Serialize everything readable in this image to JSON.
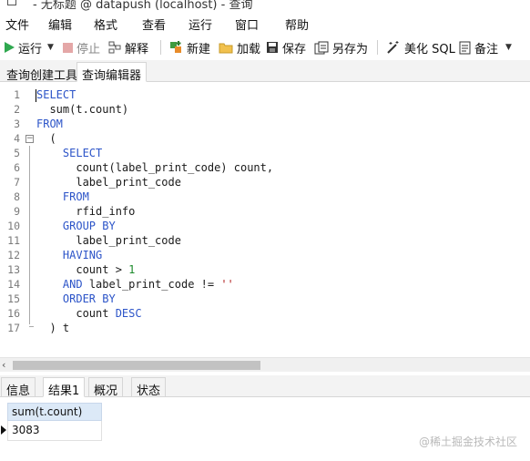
{
  "window": {
    "title": "- 无标题 @ datapush (localhost) - 查询"
  },
  "menu": [
    "文件",
    "编辑",
    "格式",
    "查看",
    "运行",
    "窗口",
    "帮助"
  ],
  "toolbar": {
    "run": "运行",
    "stop": "停止",
    "explain": "解释",
    "new": "新建",
    "load": "加载",
    "save": "保存",
    "save_as": "另存为",
    "beautify": "美化 SQL",
    "comment": "备注"
  },
  "editor_tabs": [
    "查询创建工具",
    "查询编辑器"
  ],
  "active_editor_tab": "查询编辑器",
  "code_lines": [
    {
      "n": "1",
      "parts": [
        [
          "kw",
          "SELECT"
        ]
      ]
    },
    {
      "n": "2",
      "parts": [
        [
          "t",
          "  sum(t.count)"
        ]
      ]
    },
    {
      "n": "3",
      "parts": [
        [
          "kw",
          "FROM"
        ]
      ]
    },
    {
      "n": "4",
      "parts": [
        [
          "t",
          "  ("
        ]
      ]
    },
    {
      "n": "5",
      "parts": [
        [
          "t",
          "    "
        ],
        [
          "kw",
          "SELECT"
        ]
      ]
    },
    {
      "n": "6",
      "parts": [
        [
          "t",
          "      count(label_print_code) count,"
        ]
      ]
    },
    {
      "n": "7",
      "parts": [
        [
          "t",
          "      label_print_code"
        ]
      ]
    },
    {
      "n": "8",
      "parts": [
        [
          "t",
          "    "
        ],
        [
          "kw",
          "FROM"
        ]
      ]
    },
    {
      "n": "9",
      "parts": [
        [
          "t",
          "      rfid_info"
        ]
      ]
    },
    {
      "n": "10",
      "parts": [
        [
          "t",
          "    "
        ],
        [
          "kw",
          "GROUP BY"
        ]
      ]
    },
    {
      "n": "11",
      "parts": [
        [
          "t",
          "      label_print_code"
        ]
      ]
    },
    {
      "n": "12",
      "parts": [
        [
          "t",
          "    "
        ],
        [
          "kw",
          "HAVING"
        ]
      ]
    },
    {
      "n": "13",
      "parts": [
        [
          "t",
          "      count > "
        ],
        [
          "num",
          "1"
        ]
      ]
    },
    {
      "n": "14",
      "parts": [
        [
          "t",
          "    "
        ],
        [
          "kw",
          "AND"
        ],
        [
          "t",
          " label_print_code != "
        ],
        [
          "str",
          "''"
        ]
      ]
    },
    {
      "n": "15",
      "parts": [
        [
          "t",
          "    "
        ],
        [
          "kw",
          "ORDER BY"
        ]
      ]
    },
    {
      "n": "16",
      "parts": [
        [
          "t",
          "      count "
        ],
        [
          "kw",
          "DESC"
        ]
      ]
    },
    {
      "n": "17",
      "parts": [
        [
          "t",
          "  ) t"
        ]
      ]
    }
  ],
  "result_tabs": [
    "信息",
    "结果1",
    "概况",
    "状态"
  ],
  "active_result_tab": "结果1",
  "result": {
    "columns": [
      "sum(t.count)"
    ],
    "rows": [
      [
        "3083"
      ]
    ]
  },
  "watermark": "@稀土掘金技术社区",
  "colors": {
    "keyword": "#2c54c8",
    "number": "#1c8a2a",
    "string": "#b22222",
    "header_bg": "#dce9f7"
  }
}
